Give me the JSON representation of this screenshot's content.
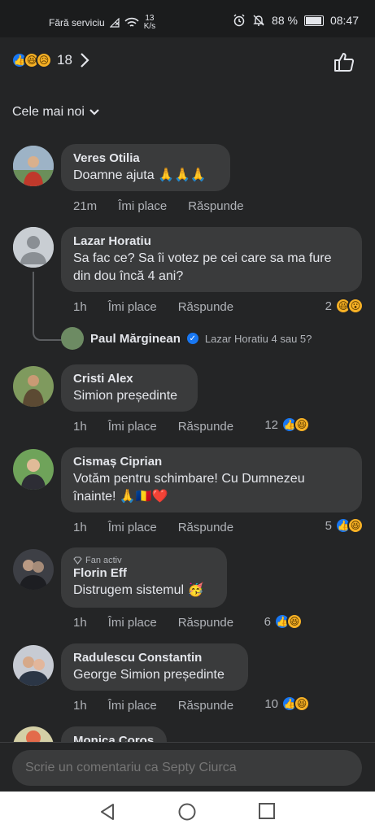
{
  "status": {
    "carrier": "Fără serviciu",
    "speed_value": "13",
    "speed_unit": "K/s",
    "battery": "88 %",
    "battery_level": 0.88,
    "time": "08:47"
  },
  "header": {
    "reaction_count": "18"
  },
  "sort": {
    "label": "Cele mai noi"
  },
  "comments": [
    {
      "author": "Veres Otilia",
      "text": "Doamne ajuta 🙏🙏🙏",
      "time": "21m",
      "like": "Îmi place",
      "reply": "Răspunde",
      "reactions": ""
    },
    {
      "author": "Lazar Horatiu",
      "text": "Sa fac  ce? Sa îi  votez  pe cei          care sa ma fure din dou încă 4 ani?",
      "time": "1h",
      "like": "Îmi place",
      "reply": "Răspunde",
      "reactions": "2"
    },
    {
      "author": "Cristi Alex",
      "text": "Simion președinte",
      "time": "1h",
      "like": "Îmi place",
      "reply": "Răspunde",
      "reactions": "12"
    },
    {
      "author": "Cismaș Ciprian",
      "text": "Votăm pentru schimbare! Cu Dumnezeu înainte! 🙏🇷🇴❤️",
      "time": "1h",
      "like": "Îmi place",
      "reply": "Răspunde",
      "reactions": "5"
    },
    {
      "badge": "Fan activ",
      "author": "Florin Eff",
      "text": "Distrugem sistemul 🥳",
      "time": "1h",
      "like": "Îmi place",
      "reply": "Răspunde",
      "reactions": "6"
    },
    {
      "author": "Radulescu Constantin",
      "text": "George Simion președinte",
      "time": "1h",
      "like": "Îmi place",
      "reply": "Răspunde",
      "reactions": "10"
    },
    {
      "author": "Monica Coros"
    }
  ],
  "reply_preview": {
    "author": "Paul Mărginean",
    "text": "Lazar Horatiu 4 sau 5?"
  },
  "composer": {
    "placeholder": "Scrie un comentariu ca Septy Ciurca"
  },
  "colors": {
    "background": "#242526",
    "bubble": "#3a3b3c",
    "like_blue": "#1877f2",
    "emoji_yellow": "#f7b125"
  }
}
